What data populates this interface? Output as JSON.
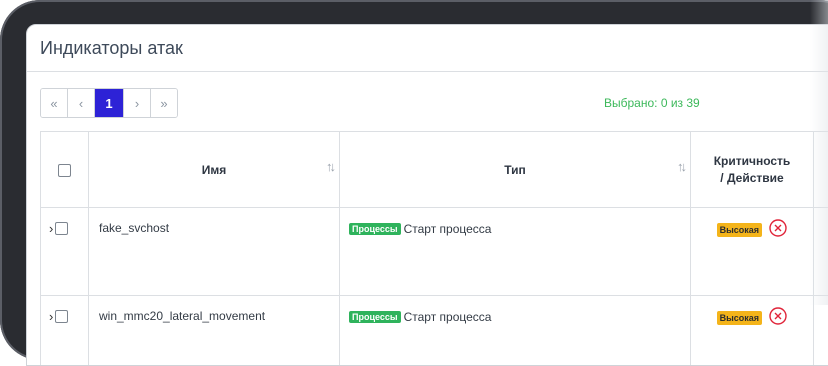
{
  "header": {
    "title": "Индикаторы атак"
  },
  "pagination": {
    "first": "«",
    "prev": "‹",
    "current": "1",
    "next": "›",
    "last": "»"
  },
  "selection": {
    "text": "Выбрано: 0 из 39"
  },
  "table": {
    "columns": {
      "name": "Имя",
      "type": "Тип",
      "crit_line1": "Критичность",
      "crit_line2": "/ Действие"
    },
    "rows": [
      {
        "name": "fake_svchost",
        "type_badge": "Процессы",
        "type_text": "Старт процесса",
        "criticality": "Высокая"
      },
      {
        "name": "win_mmc20_lateral_movement",
        "type_badge": "Процессы",
        "type_text": "Старт процесса",
        "criticality": "Высокая"
      }
    ]
  },
  "colors": {
    "accent": "#2d22d6",
    "success": "#3cb85a",
    "badge_green": "#2fb35c",
    "badge_yellow": "#f4b41a",
    "danger": "#e0253a"
  }
}
